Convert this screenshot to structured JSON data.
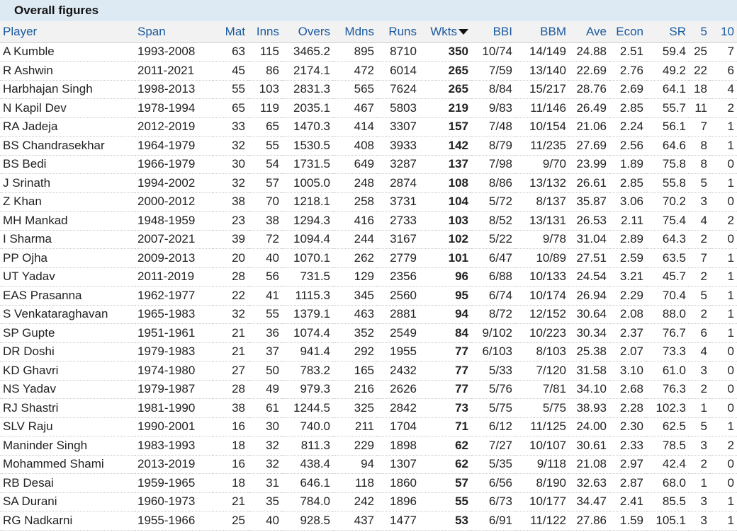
{
  "title": "Overall figures",
  "columns": [
    "Player",
    "Span",
    "Mat",
    "Inns",
    "Overs",
    "Mdns",
    "Runs",
    "Wkts",
    "BBI",
    "BBM",
    "Ave",
    "Econ",
    "SR",
    "5",
    "10"
  ],
  "rows": [
    [
      "A Kumble",
      "1993-2008",
      "63",
      "115",
      "3465.2",
      "895",
      "8710",
      "350",
      "10/74",
      "14/149",
      "24.88",
      "2.51",
      "59.4",
      "25",
      "7"
    ],
    [
      "R Ashwin",
      "2011-2021",
      "45",
      "86",
      "2174.1",
      "472",
      "6014",
      "265",
      "7/59",
      "13/140",
      "22.69",
      "2.76",
      "49.2",
      "22",
      "6"
    ],
    [
      "Harbhajan Singh",
      "1998-2013",
      "55",
      "103",
      "2831.3",
      "565",
      "7624",
      "265",
      "8/84",
      "15/217",
      "28.76",
      "2.69",
      "64.1",
      "18",
      "4"
    ],
    [
      "N Kapil Dev",
      "1978-1994",
      "65",
      "119",
      "2035.1",
      "467",
      "5803",
      "219",
      "9/83",
      "11/146",
      "26.49",
      "2.85",
      "55.7",
      "11",
      "2"
    ],
    [
      "RA Jadeja",
      "2012-2019",
      "33",
      "65",
      "1470.3",
      "414",
      "3307",
      "157",
      "7/48",
      "10/154",
      "21.06",
      "2.24",
      "56.1",
      "7",
      "1"
    ],
    [
      "BS Chandrasekhar",
      "1964-1979",
      "32",
      "55",
      "1530.5",
      "408",
      "3933",
      "142",
      "8/79",
      "11/235",
      "27.69",
      "2.56",
      "64.6",
      "8",
      "1"
    ],
    [
      "BS Bedi",
      "1966-1979",
      "30",
      "54",
      "1731.5",
      "649",
      "3287",
      "137",
      "7/98",
      "9/70",
      "23.99",
      "1.89",
      "75.8",
      "8",
      "0"
    ],
    [
      "J Srinath",
      "1994-2002",
      "32",
      "57",
      "1005.0",
      "248",
      "2874",
      "108",
      "8/86",
      "13/132",
      "26.61",
      "2.85",
      "55.8",
      "5",
      "1"
    ],
    [
      "Z Khan",
      "2000-2012",
      "38",
      "70",
      "1218.1",
      "258",
      "3731",
      "104",
      "5/72",
      "8/137",
      "35.87",
      "3.06",
      "70.2",
      "3",
      "0"
    ],
    [
      "MH Mankad",
      "1948-1959",
      "23",
      "38",
      "1294.3",
      "416",
      "2733",
      "103",
      "8/52",
      "13/131",
      "26.53",
      "2.11",
      "75.4",
      "4",
      "2"
    ],
    [
      "I Sharma",
      "2007-2021",
      "39",
      "72",
      "1094.4",
      "244",
      "3167",
      "102",
      "5/22",
      "9/78",
      "31.04",
      "2.89",
      "64.3",
      "2",
      "0"
    ],
    [
      "PP Ojha",
      "2009-2013",
      "20",
      "40",
      "1070.1",
      "262",
      "2779",
      "101",
      "6/47",
      "10/89",
      "27.51",
      "2.59",
      "63.5",
      "7",
      "1"
    ],
    [
      "UT Yadav",
      "2011-2019",
      "28",
      "56",
      "731.5",
      "129",
      "2356",
      "96",
      "6/88",
      "10/133",
      "24.54",
      "3.21",
      "45.7",
      "2",
      "1"
    ],
    [
      "EAS Prasanna",
      "1962-1977",
      "22",
      "41",
      "1115.3",
      "345",
      "2560",
      "95",
      "6/74",
      "10/174",
      "26.94",
      "2.29",
      "70.4",
      "5",
      "1"
    ],
    [
      "S Venkataraghavan",
      "1965-1983",
      "32",
      "55",
      "1379.1",
      "463",
      "2881",
      "94",
      "8/72",
      "12/152",
      "30.64",
      "2.08",
      "88.0",
      "2",
      "1"
    ],
    [
      "SP Gupte",
      "1951-1961",
      "21",
      "36",
      "1074.4",
      "352",
      "2549",
      "84",
      "9/102",
      "10/223",
      "30.34",
      "2.37",
      "76.7",
      "6",
      "1"
    ],
    [
      "DR Doshi",
      "1979-1983",
      "21",
      "37",
      "941.4",
      "292",
      "1955",
      "77",
      "6/103",
      "8/103",
      "25.38",
      "2.07",
      "73.3",
      "4",
      "0"
    ],
    [
      "KD Ghavri",
      "1974-1980",
      "27",
      "50",
      "783.2",
      "165",
      "2432",
      "77",
      "5/33",
      "7/120",
      "31.58",
      "3.10",
      "61.0",
      "3",
      "0"
    ],
    [
      "NS Yadav",
      "1979-1987",
      "28",
      "49",
      "979.3",
      "216",
      "2626",
      "77",
      "5/76",
      "7/81",
      "34.10",
      "2.68",
      "76.3",
      "2",
      "0"
    ],
    [
      "RJ Shastri",
      "1981-1990",
      "38",
      "61",
      "1244.5",
      "325",
      "2842",
      "73",
      "5/75",
      "5/75",
      "38.93",
      "2.28",
      "102.3",
      "1",
      "0"
    ],
    [
      "SLV Raju",
      "1990-2001",
      "16",
      "30",
      "740.0",
      "211",
      "1704",
      "71",
      "6/12",
      "11/125",
      "24.00",
      "2.30",
      "62.5",
      "5",
      "1"
    ],
    [
      "Maninder Singh",
      "1983-1993",
      "18",
      "32",
      "811.3",
      "229",
      "1898",
      "62",
      "7/27",
      "10/107",
      "30.61",
      "2.33",
      "78.5",
      "3",
      "2"
    ],
    [
      "Mohammed Shami",
      "2013-2019",
      "16",
      "32",
      "438.4",
      "94",
      "1307",
      "62",
      "5/35",
      "9/118",
      "21.08",
      "2.97",
      "42.4",
      "2",
      "0"
    ],
    [
      "RB Desai",
      "1959-1965",
      "18",
      "31",
      "646.1",
      "118",
      "1860",
      "57",
      "6/56",
      "8/190",
      "32.63",
      "2.87",
      "68.0",
      "1",
      "0"
    ],
    [
      "SA Durani",
      "1960-1973",
      "21",
      "35",
      "784.0",
      "242",
      "1896",
      "55",
      "6/73",
      "10/177",
      "34.47",
      "2.41",
      "85.5",
      "3",
      "1"
    ],
    [
      "RG Nadkarni",
      "1955-1966",
      "25",
      "40",
      "928.5",
      "437",
      "1477",
      "53",
      "6/91",
      "11/122",
      "27.86",
      "1.59",
      "105.1",
      "3",
      "1"
    ]
  ],
  "sort": {
    "column": "Wkts",
    "direction": "descending",
    "icon": "sort-down-icon"
  }
}
